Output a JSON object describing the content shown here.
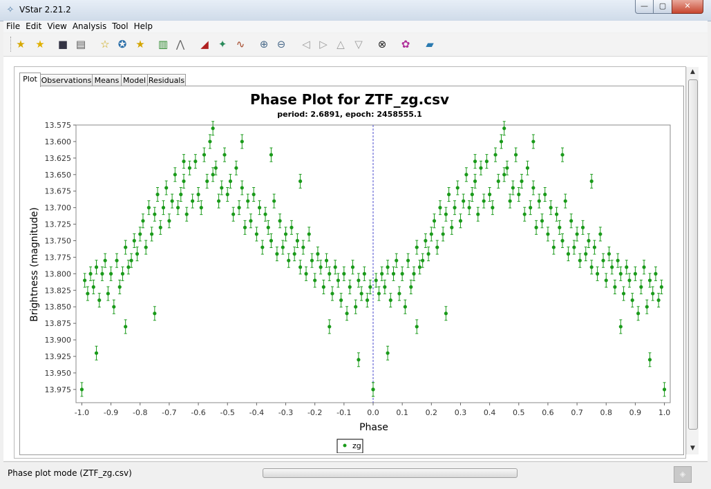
{
  "window": {
    "title": "VStar 2.21.2",
    "min_label": "—",
    "max_label": "▢",
    "close_label": "✕"
  },
  "menu": [
    "File",
    "Edit",
    "View",
    "Analysis",
    "Tool",
    "Help"
  ],
  "toolbar": [
    {
      "icon": "new-star-icon",
      "glyph": "★",
      "color": "#d6a800"
    },
    {
      "icon": "open-star-icon",
      "glyph": "★",
      "color": "#e0b000"
    },
    {
      "icon": "save-icon",
      "glyph": "■",
      "color": "#334"
    },
    {
      "icon": "print-icon",
      "glyph": "▤",
      "color": "#555"
    },
    {
      "icon": "star-info-icon",
      "glyph": "☆",
      "color": "#c9a100"
    },
    {
      "icon": "star-list-icon",
      "glyph": "✪",
      "color": "#2a6ea8"
    },
    {
      "icon": "star-details-icon",
      "glyph": "★",
      "color": "#d4a500"
    },
    {
      "icon": "plot-obs-icon",
      "glyph": "▥",
      "color": "#2d8a2d"
    },
    {
      "icon": "plot-means-icon",
      "glyph": "⋀",
      "color": "#666"
    },
    {
      "icon": "polynomial-fit-icon",
      "glyph": "◢",
      "color": "#b02020"
    },
    {
      "icon": "phase-plot-icon",
      "glyph": "✦",
      "color": "#2a8a5a"
    },
    {
      "icon": "model-icon",
      "glyph": "∿",
      "color": "#a04020"
    },
    {
      "icon": "zoom-in-icon",
      "glyph": "⊕",
      "color": "#4a6a8a"
    },
    {
      "icon": "zoom-out-icon",
      "glyph": "⊖",
      "color": "#4a6a8a"
    },
    {
      "icon": "pan-left-icon",
      "glyph": "◁",
      "color": "#9a9a9a"
    },
    {
      "icon": "pan-right-icon",
      "glyph": "▷",
      "color": "#9a9a9a"
    },
    {
      "icon": "pan-up-icon",
      "glyph": "△",
      "color": "#9a9a9a"
    },
    {
      "icon": "pan-down-icon",
      "glyph": "▽",
      "color": "#9a9a9a"
    },
    {
      "icon": "binoculars-icon",
      "glyph": "⊗",
      "color": "#222"
    },
    {
      "icon": "filter-icon",
      "glyph": "✿",
      "color": "#b0309a"
    },
    {
      "icon": "info-book-icon",
      "glyph": "▰",
      "color": "#2a7ab0"
    }
  ],
  "tabs": [
    "Plot",
    "Observations",
    "Means",
    "Model",
    "Residuals"
  ],
  "status": {
    "text": "Phase plot mode (ZTF_zg.csv)"
  },
  "chart_data": {
    "type": "scatter",
    "title": "Phase Plot for ZTF_zg.csv",
    "subtitle": "period: 2.6891, epoch: 2458555.1",
    "xlabel": "Phase",
    "ylabel": "Brightness (magnitude)",
    "xlim": [
      -1.02,
      1.02
    ],
    "ylim": [
      13.575,
      13.995
    ],
    "y_inverted": true,
    "x_ticks": [
      "-1.0",
      "-0.9",
      "-0.8",
      "-0.7",
      "-0.6",
      "-0.5",
      "-0.4",
      "-0.3",
      "-0.2",
      "-0.1",
      "0.0",
      "0.1",
      "0.2",
      "0.3",
      "0.4",
      "0.5",
      "0.6",
      "0.7",
      "0.8",
      "0.9",
      "1.0"
    ],
    "y_ticks": [
      "13.575",
      "13.600",
      "13.625",
      "13.650",
      "13.675",
      "13.700",
      "13.725",
      "13.750",
      "13.775",
      "13.800",
      "13.825",
      "13.850",
      "13.875",
      "13.900",
      "13.925",
      "13.950",
      "13.975"
    ],
    "legend": [
      "zg"
    ],
    "legend_position": "bottom-center",
    "marker_color": "#1a9a1a",
    "zero_line": true,
    "series": [
      {
        "name": "zg",
        "x": [
          0.0,
          0.01,
          0.02,
          0.03,
          0.04,
          0.05,
          0.06,
          0.07,
          0.08,
          0.09,
          0.1,
          0.11,
          0.12,
          0.13,
          0.14,
          0.15,
          0.16,
          0.17,
          0.18,
          0.19,
          0.2,
          0.21,
          0.22,
          0.23,
          0.24,
          0.25,
          0.26,
          0.27,
          0.28,
          0.29,
          0.3,
          0.31,
          0.32,
          0.33,
          0.34,
          0.35,
          0.36,
          0.37,
          0.38,
          0.39,
          0.4,
          0.41,
          0.42,
          0.43,
          0.44,
          0.45,
          0.46,
          0.47,
          0.48,
          0.49,
          0.5,
          0.51,
          0.52,
          0.53,
          0.54,
          0.55,
          0.56,
          0.57,
          0.58,
          0.59,
          0.6,
          0.61,
          0.62,
          0.63,
          0.64,
          0.65,
          0.66,
          0.67,
          0.68,
          0.69,
          0.7,
          0.71,
          0.72,
          0.73,
          0.74,
          0.75,
          0.76,
          0.77,
          0.78,
          0.79,
          0.8,
          0.81,
          0.82,
          0.83,
          0.84,
          0.85,
          0.86,
          0.87,
          0.88,
          0.89,
          0.9,
          0.91,
          0.92,
          0.93,
          0.94,
          0.95,
          0.96,
          0.97,
          0.98,
          0.99,
          1.0,
          0.05,
          0.15,
          0.25,
          0.35,
          0.45,
          0.55,
          0.65,
          0.75,
          0.85,
          0.95
        ],
        "y": [
          13.975,
          13.81,
          13.83,
          13.8,
          13.82,
          13.79,
          13.84,
          13.8,
          13.78,
          13.83,
          13.8,
          13.85,
          13.78,
          13.82,
          13.8,
          13.76,
          13.79,
          13.78,
          13.75,
          13.77,
          13.74,
          13.72,
          13.76,
          13.7,
          13.74,
          13.71,
          13.68,
          13.73,
          13.7,
          13.67,
          13.72,
          13.69,
          13.65,
          13.7,
          13.68,
          13.66,
          13.71,
          13.64,
          13.69,
          13.63,
          13.68,
          13.7,
          13.62,
          13.66,
          13.6,
          13.65,
          13.64,
          13.69,
          13.67,
          13.62,
          13.68,
          13.66,
          13.71,
          13.64,
          13.7,
          13.67,
          13.73,
          13.69,
          13.72,
          13.68,
          13.74,
          13.7,
          13.76,
          13.71,
          13.73,
          13.75,
          13.69,
          13.77,
          13.72,
          13.76,
          13.74,
          13.78,
          13.73,
          13.77,
          13.75,
          13.79,
          13.76,
          13.8,
          13.74,
          13.78,
          13.81,
          13.77,
          13.79,
          13.82,
          13.78,
          13.8,
          13.83,
          13.79,
          13.81,
          13.84,
          13.8,
          13.86,
          13.82,
          13.79,
          13.85,
          13.81,
          13.83,
          13.8,
          13.84,
          13.82,
          13.975,
          13.92,
          13.88,
          13.86,
          13.63,
          13.58,
          13.6,
          13.62,
          13.66,
          13.88,
          13.93
        ]
      }
    ]
  }
}
